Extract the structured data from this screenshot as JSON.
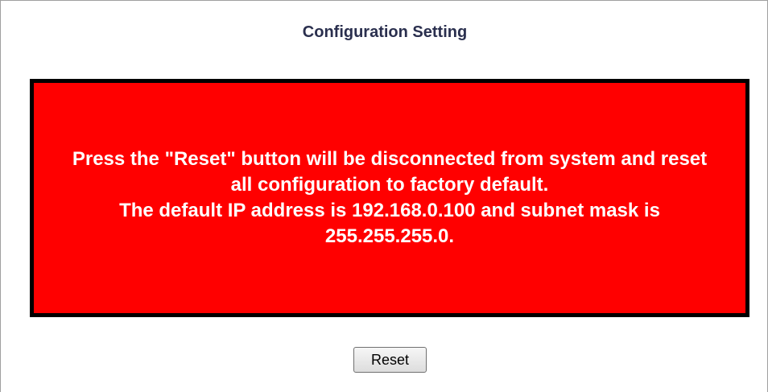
{
  "page": {
    "title": "Configuration Setting"
  },
  "warning": {
    "line1": "Press the \"Reset\" button will be disconnected from system and reset all configuration to factory default.",
    "line2": "The default IP address is 192.168.0.100 and subnet mask is 255.255.255.0.",
    "background_color": "#ff0000",
    "border_color": "#000000",
    "text_color": "#ffffff"
  },
  "actions": {
    "reset_label": "Reset"
  }
}
